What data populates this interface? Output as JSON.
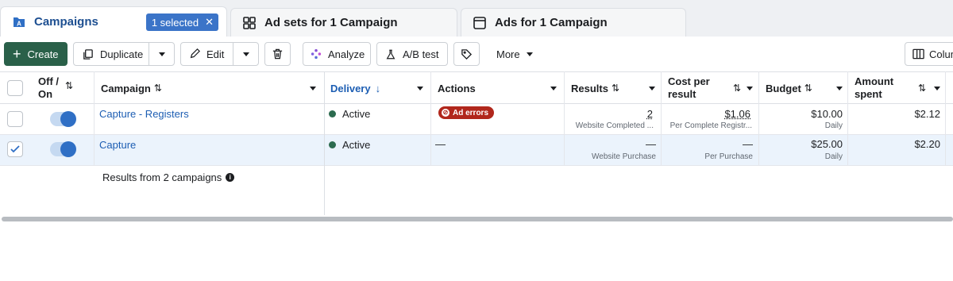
{
  "tabs": {
    "campaigns": "Campaigns",
    "selected_badge": "1 selected",
    "ad_sets": "Ad sets for 1 Campaign",
    "ads": "Ads for 1 Campaign"
  },
  "toolbar": {
    "create": "Create",
    "duplicate": "Duplicate",
    "edit": "Edit",
    "analyze": "Analyze",
    "ab_test": "A/B test",
    "more": "More",
    "columns": "Colum"
  },
  "columns": {
    "off_on": "Off /\nOn",
    "campaign": "Campaign",
    "delivery": "Delivery",
    "actions": "Actions",
    "results": "Results",
    "cost_per_result": "Cost per\nresult",
    "budget": "Budget",
    "amount_spent": "Amount\nspent"
  },
  "rows": [
    {
      "campaign": "Capture - Registers",
      "delivery": "Active",
      "actions_badge": "Ad errors",
      "results": "2",
      "results_sub": "Website Completed ...",
      "cost": "$1.06",
      "cost_sub": "Per Complete Registr...",
      "budget": "$10.00",
      "budget_sub": "Daily",
      "spent": "$2.12"
    },
    {
      "campaign": "Capture",
      "delivery": "Active",
      "actions": "—",
      "results": "—",
      "results_sub": "Website Purchase",
      "cost": "—",
      "cost_sub": "Per Purchase",
      "budget": "$25.00",
      "budget_sub": "Daily",
      "spent": "$2.20"
    }
  ],
  "summary": "Results from 2 campaigns",
  "colors": {
    "accent_blue": "#1d5eb3",
    "create_green": "#2a6049",
    "active_dot": "#2c6b4f",
    "error_red": "#b1271c",
    "selected_row": "#ebf3fc"
  }
}
